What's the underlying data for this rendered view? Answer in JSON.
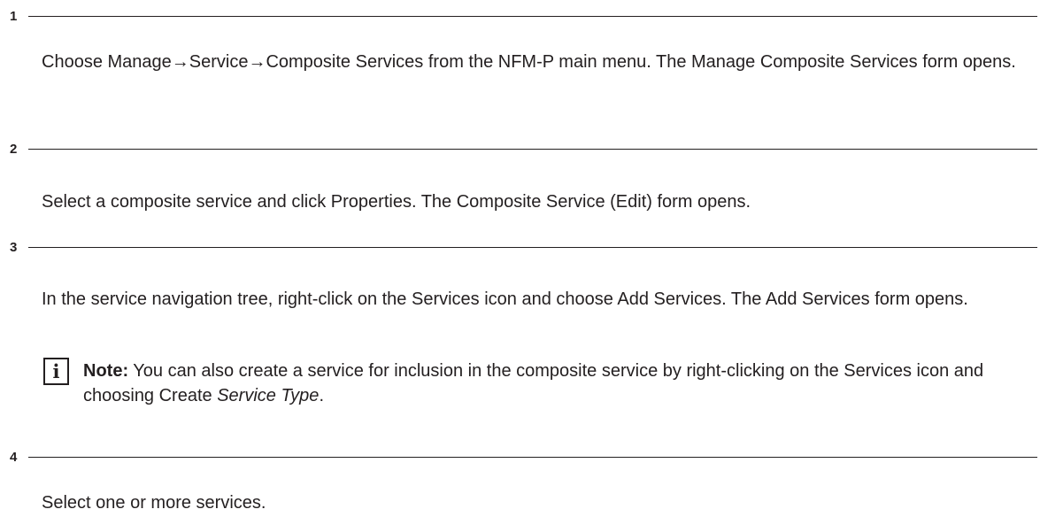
{
  "steps": [
    {
      "number": "1",
      "text": "Choose Manage→Service→Composite Services from the NFM-P main menu. The Manage Composite Services form opens."
    },
    {
      "number": "2",
      "text": "Select a composite service and click Properties. The Composite Service (Edit) form opens."
    },
    {
      "number": "3",
      "text": "In the service navigation tree, right-click on the Services icon and choose Add Services. The Add Services form opens.",
      "note": {
        "icon_glyph": "i",
        "label": "Note:",
        "text": " You can also create a service for inclusion in the composite service by right-clicking on the Services icon and choosing Create ",
        "emphasis": "Service Type",
        "tail": "."
      }
    },
    {
      "number": "4",
      "text": "Select one or more services."
    }
  ]
}
